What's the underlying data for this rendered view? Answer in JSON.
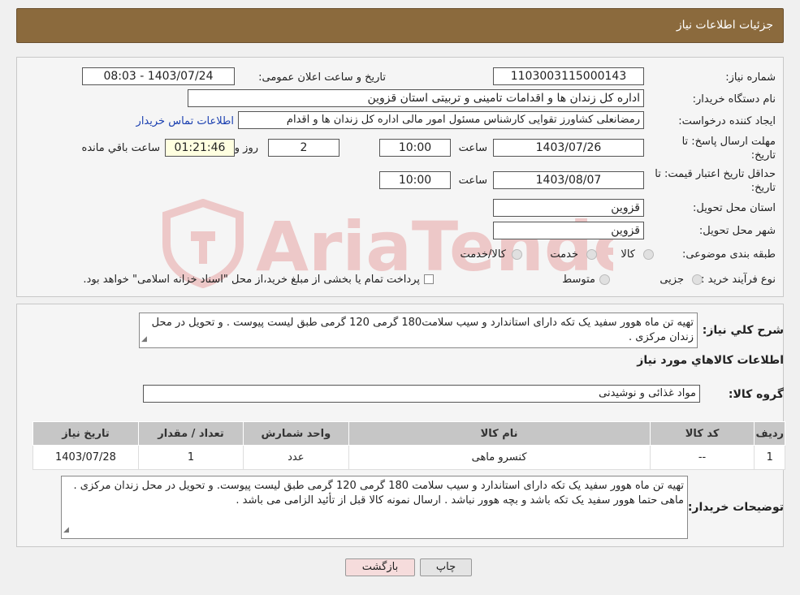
{
  "header": {
    "title": "جزئیات اطلاعات نیاز"
  },
  "form": {
    "need_number_label": "شماره نیاز:",
    "need_number": "1103003115000143",
    "announce_label": "تاریخ و ساعت اعلان عمومی:",
    "announce_value": "1403/07/24 - 08:03",
    "buyer_org_label": "نام دستگاه خریدار:",
    "buyer_org": "اداره کل زندان ها و اقدامات تامینی و تربیتی استان قزوین",
    "requester_label": "ایجاد کننده درخواست:",
    "requester": "رمضانعلی کشاورز تقوایی کارشناس مسئول امور مالی  اداره کل زندان ها و اقدام",
    "contact_link": "اطلاعات تماس خریدار",
    "reply_deadline_label_1": "مهلت ارسال پاسخ: تا",
    "reply_deadline_label_2": "تاریخ:",
    "reply_date": "1403/07/26",
    "time_label": "ساعت",
    "reply_time": "10:00",
    "days_value": "2",
    "days_label": "روز و",
    "remaining_time": "01:21:46",
    "remaining_label": "ساعت باقي مانده",
    "price_validity_label_1": "حداقل تاریخ اعتبار قیمت: تا",
    "price_validity_label_2": "تاریخ:",
    "validity_date": "1403/08/07",
    "validity_time": "10:00",
    "province_label": "استان محل تحویل:",
    "province": "قزوین",
    "city_label": "شهر محل تحویل:",
    "city": "قزوین",
    "category_label": "طبقه بندی موضوعی:",
    "category_options": [
      "کالا",
      "خدمت",
      "کالا/خدمت"
    ],
    "process_label": "نوع فرآیند خرید :",
    "process_options": [
      "جزیی",
      "متوسط"
    ],
    "payment_note": "پرداخت تمام یا بخشی از مبلغ خرید،از محل \"اسناد خزانه اسلامی\" خواهد بود."
  },
  "summary": {
    "label": "شرح کلي نياز:",
    "text": "تهیه تن ماه هوور سفید یک تکه دارای استاندارد و سیب سلامت180 گرمی 120 گرمی طبق لیست پیوست . و تحویل در محل زندان مرکزی ."
  },
  "goods_section": {
    "title": "اطلاعات کالاهاي مورد نياز",
    "group_label": "گروه کالا:",
    "group_value": "مواد غذائی و نوشیدنی"
  },
  "table": {
    "headers": [
      "ردیف",
      "کد کالا",
      "نام کالا",
      "واحد شمارش",
      "تعداد / مقدار",
      "تاریخ نیاز"
    ],
    "rows": [
      [
        "1",
        "--",
        "کنسرو ماهی",
        "عدد",
        "1",
        "1403/07/28"
      ]
    ]
  },
  "buyer_notes": {
    "label": "توضیحات خریدار:",
    "text": "تهیه تن ماه هوور سفید یک تکه دارای استاندارد و سیب سلامت 180 گرمی 120 گرمی طبق لیست پیوست. و تحویل در محل زندان مرکزی . ماهی حتما هوور سفید یک تکه باشد و بچه هوور نباشد . ارسال نمونه کالا قبل از تأئید الزامی می باشد ."
  },
  "buttons": {
    "print": "چاپ",
    "back": "بازگشت"
  },
  "watermark": "AriaTender.neT",
  "colors": {
    "header_bg": "#8b6a3d",
    "link": "#1a3fb0",
    "back_btn_bg": "#f6dcdc"
  }
}
